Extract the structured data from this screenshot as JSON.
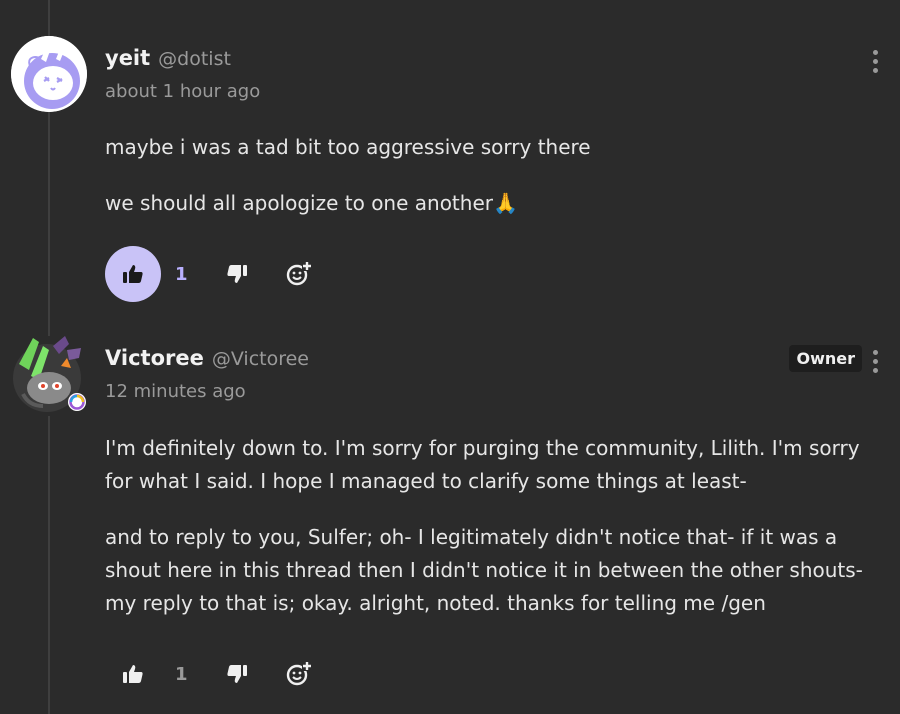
{
  "comments": [
    {
      "display_name": "yeit",
      "handle": "@dotist",
      "time": "about 1 hour ago",
      "paragraphs": [
        "maybe i was a tad bit too aggressive sorry there",
        "we should all apologize to one another🙏"
      ],
      "likes": "1",
      "liked": true,
      "avatar_icon": "bunny-avatar",
      "accent_color": "#c9c3f7"
    },
    {
      "display_name": "Victoree",
      "handle": "@Victoree",
      "time": "12 minutes ago",
      "badge": "Owner",
      "paragraphs": [
        "I'm definitely down to. I'm sorry for purging the community, Lilith. I'm sorry for what I said. I hope I managed to clarify some things at least-",
        "and to reply to you, Sulfer; oh- I legitimately didn't notice that- if it was a shout here in this thread then I didn't notice it in between the other shouts- my reply to that is; okay. alright, noted. thanks for telling me /gen"
      ],
      "likes": "1",
      "liked": false,
      "avatar_icon": "character-avatar"
    }
  ],
  "icons": {
    "like": "thumbs-up-icon",
    "dislike": "thumbs-down-icon",
    "react": "add-reaction-icon",
    "menu": "kebab-menu-icon"
  }
}
